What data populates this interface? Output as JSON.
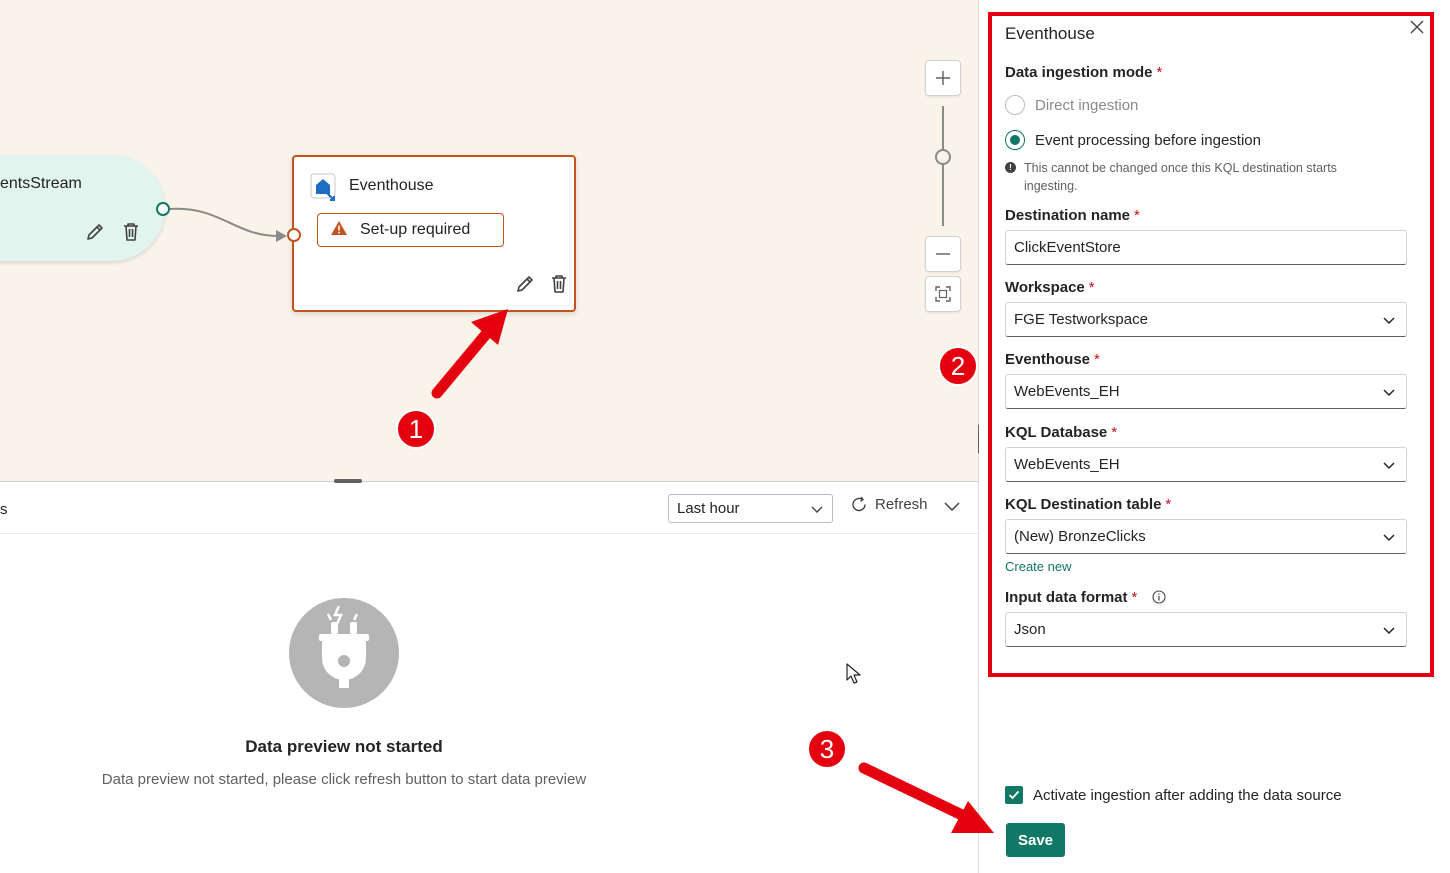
{
  "canvas": {
    "source_node": {
      "label": "entsStream"
    },
    "destination_node": {
      "title": "Eventhouse",
      "badge": "Set-up required"
    }
  },
  "preview": {
    "tab_fragment": "s",
    "time_range": "Last hour",
    "refresh_label": "Refresh",
    "empty_title": "Data preview not started",
    "empty_subtitle": "Data preview not started, please click refresh button to start data preview"
  },
  "panel": {
    "title": "Eventhouse",
    "ingestion_mode": {
      "label": "Data ingestion mode",
      "options": [
        {
          "label": "Direct ingestion",
          "selected": false,
          "disabled": true
        },
        {
          "label": "Event processing before ingestion",
          "selected": true,
          "disabled": false
        }
      ],
      "note": "This cannot be changed once this KQL destination starts ingesting."
    },
    "destination_name": {
      "label": "Destination name",
      "value": "ClickEventStore"
    },
    "workspace": {
      "label": "Workspace",
      "value": "FGE Testworkspace"
    },
    "eventhouse": {
      "label": "Eventhouse",
      "value": "WebEvents_EH"
    },
    "kql_database": {
      "label": "KQL Database",
      "value": "WebEvents_EH"
    },
    "kql_table": {
      "label": "KQL Destination table",
      "value": "(New) BronzeClicks",
      "create_new": "Create new"
    },
    "input_format": {
      "label": "Input data format",
      "value": "Json"
    },
    "required_marker": "*",
    "activate_label": "Activate ingestion after adding the data source",
    "activate_checked": true,
    "save_label": "Save"
  },
  "callouts": [
    "1",
    "2",
    "3"
  ],
  "colors": {
    "accent": "#117865",
    "warning": "#c4541f",
    "annotation": "#e4000f",
    "canvas": "#faf3ea"
  }
}
